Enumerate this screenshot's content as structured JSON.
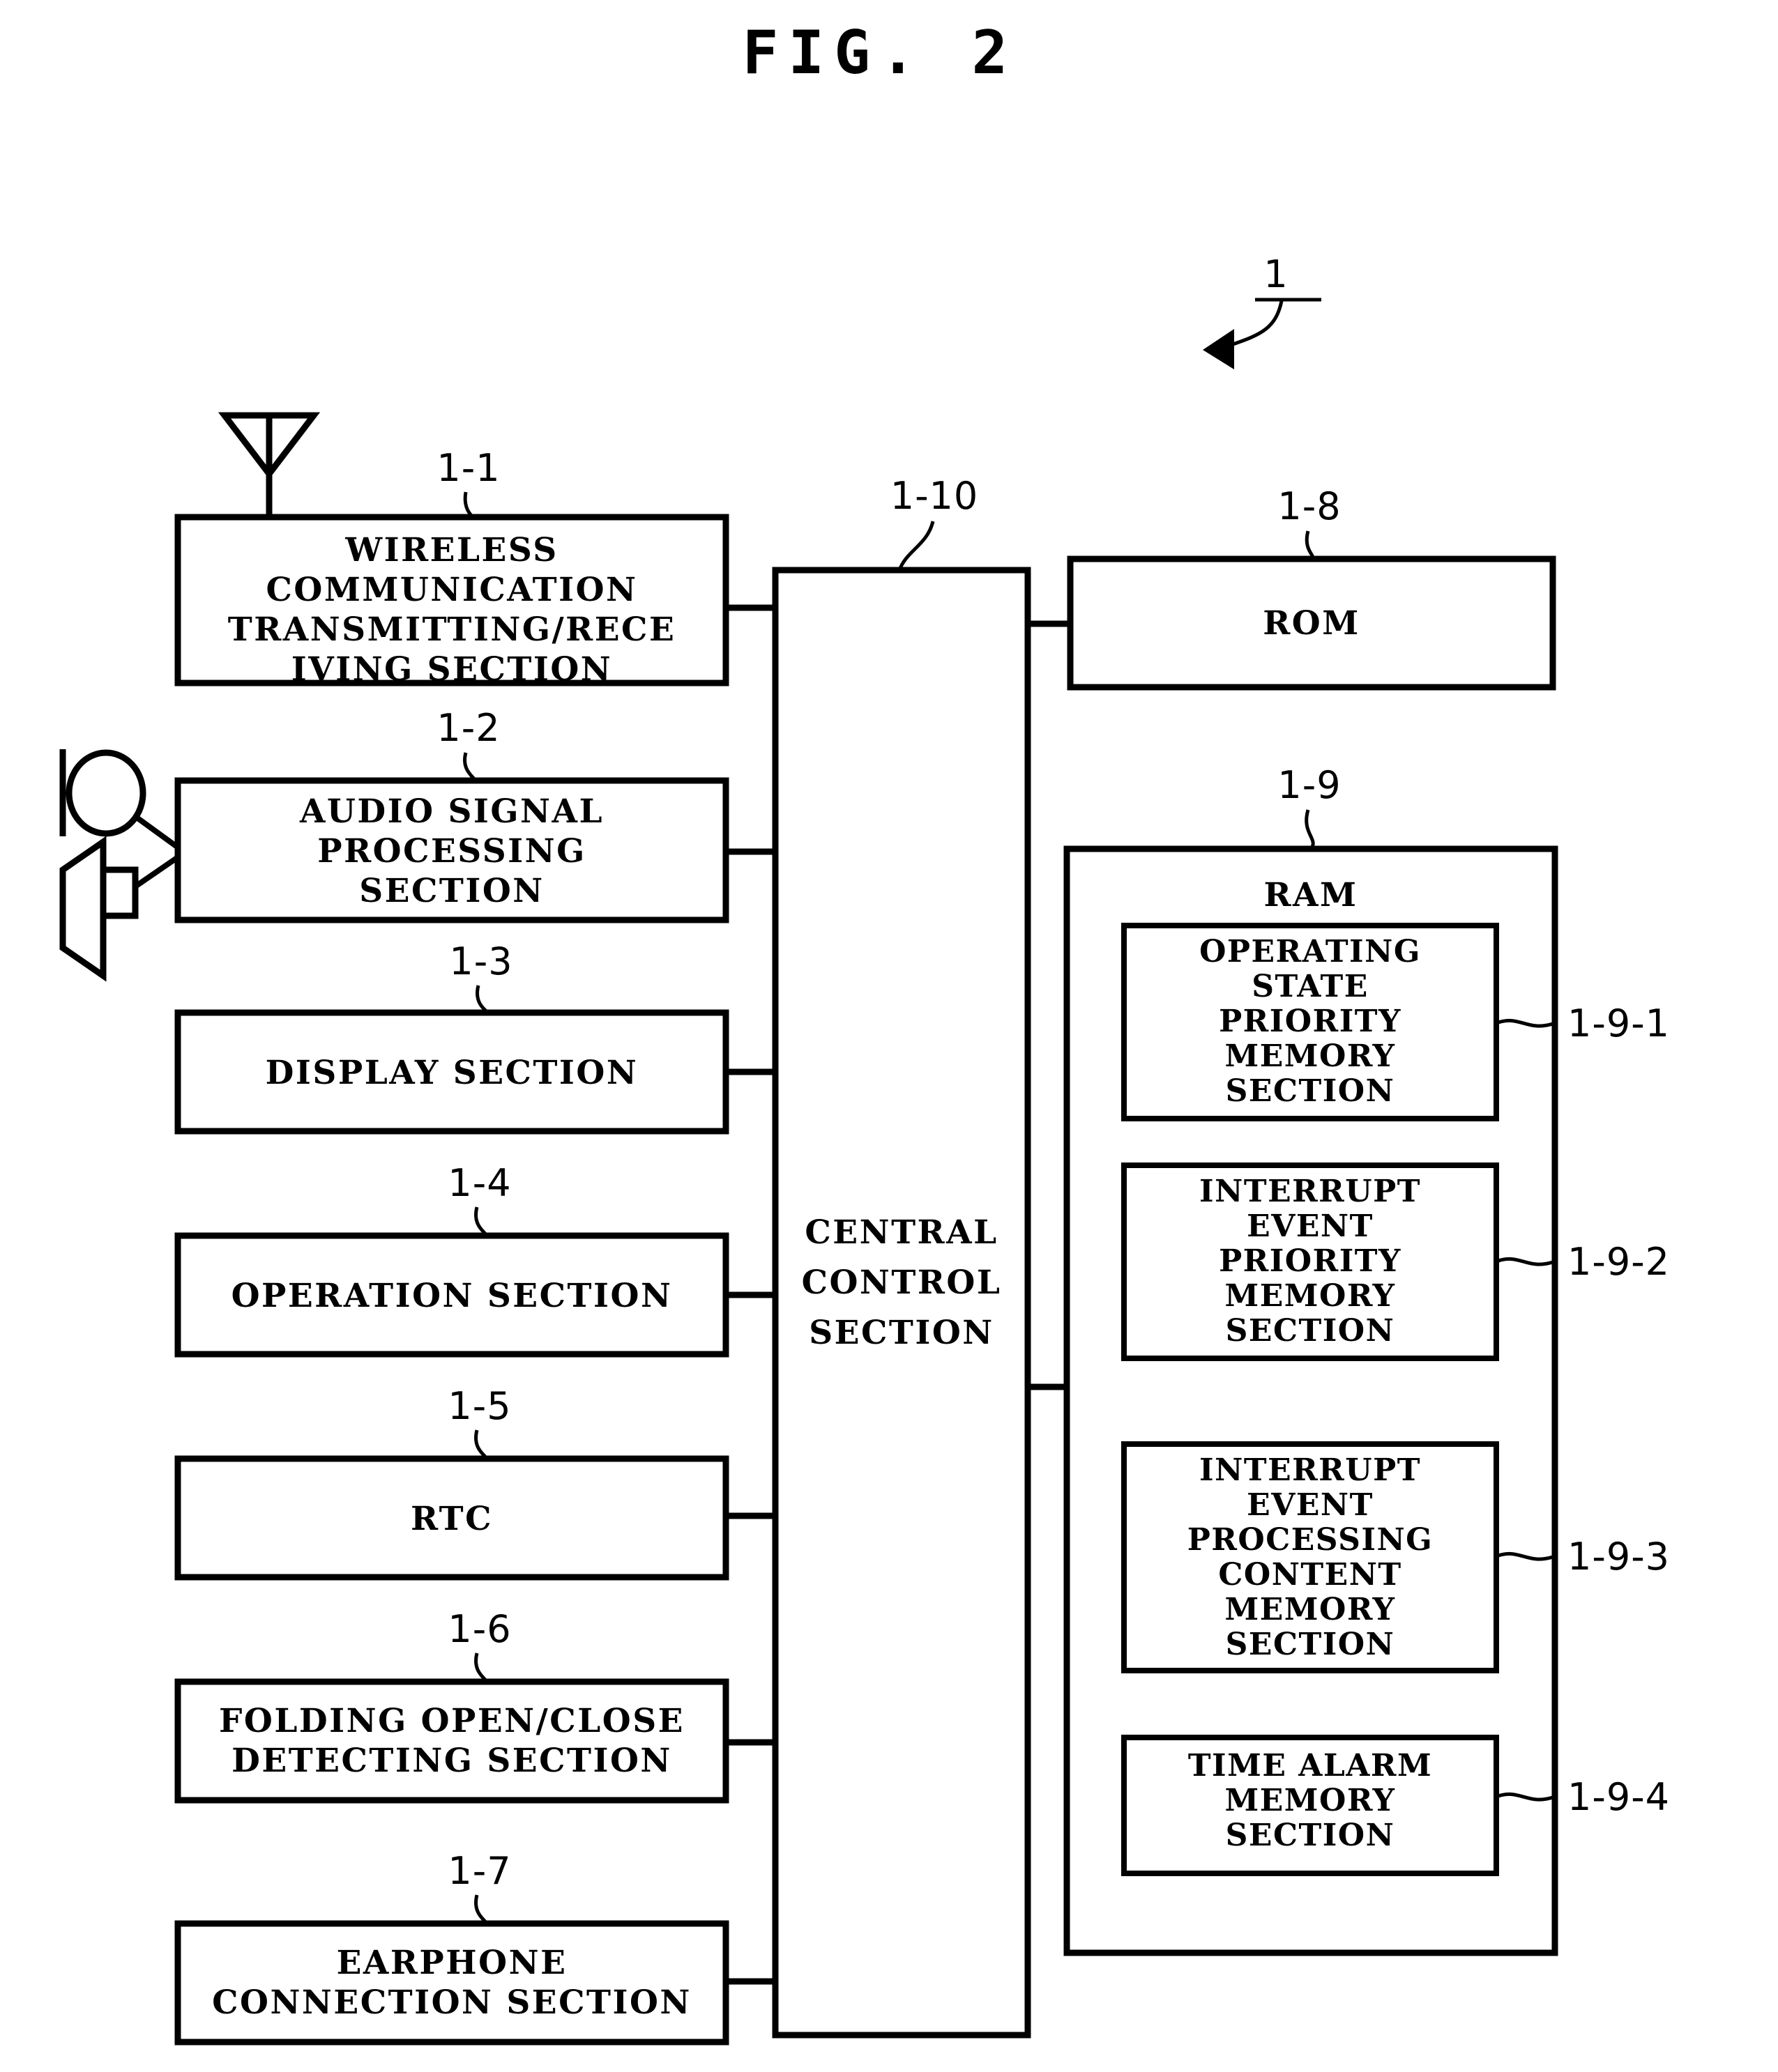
{
  "figure": {
    "title": "FIG. 2",
    "system_ref": "1"
  },
  "left_column": [
    {
      "ref": "1-1",
      "lines": [
        "WIRELESS",
        "COMMUNICATION",
        "TRANSMITTING/RECE",
        "IVING SECTION"
      ],
      "icon": "antenna-icon"
    },
    {
      "ref": "1-2",
      "lines": [
        "AUDIO SIGNAL",
        "PROCESSING",
        "SECTION"
      ],
      "icon": "microphone-and-speaker-icon"
    },
    {
      "ref": "1-3",
      "lines": [
        "DISPLAY SECTION"
      ],
      "icon": ""
    },
    {
      "ref": "1-4",
      "lines": [
        "OPERATION SECTION"
      ],
      "icon": ""
    },
    {
      "ref": "1-5",
      "lines": [
        "RTC"
      ],
      "icon": ""
    },
    {
      "ref": "1-6",
      "lines": [
        "FOLDING OPEN/CLOSE",
        "DETECTING SECTION"
      ],
      "icon": ""
    },
    {
      "ref": "1-7",
      "lines": [
        "EARPHONE",
        "CONNECTION SECTION"
      ],
      "icon": ""
    }
  ],
  "central": {
    "ref": "1-10",
    "lines": [
      "CENTRAL",
      "CONTROL",
      "SECTION"
    ]
  },
  "rom": {
    "ref": "1-8",
    "label": "ROM"
  },
  "ram": {
    "ref": "1-9",
    "label": "RAM",
    "sections": [
      {
        "ref": "1-9-1",
        "lines": [
          "OPERATING",
          "STATE",
          "PRIORITY",
          "MEMORY",
          "SECTION"
        ]
      },
      {
        "ref": "1-9-2",
        "lines": [
          "INTERRUPT",
          "EVENT",
          "PRIORITY",
          "MEMORY",
          "SECTION"
        ]
      },
      {
        "ref": "1-9-3",
        "lines": [
          "INTERRUPT",
          "EVENT",
          "PROCESSING",
          "CONTENT",
          "MEMORY",
          "SECTION"
        ]
      },
      {
        "ref": "1-9-4",
        "lines": [
          "TIME ALARM",
          "MEMORY",
          "SECTION"
        ]
      }
    ]
  },
  "colors": {
    "ink": "#000000",
    "paper": "#ffffff"
  }
}
